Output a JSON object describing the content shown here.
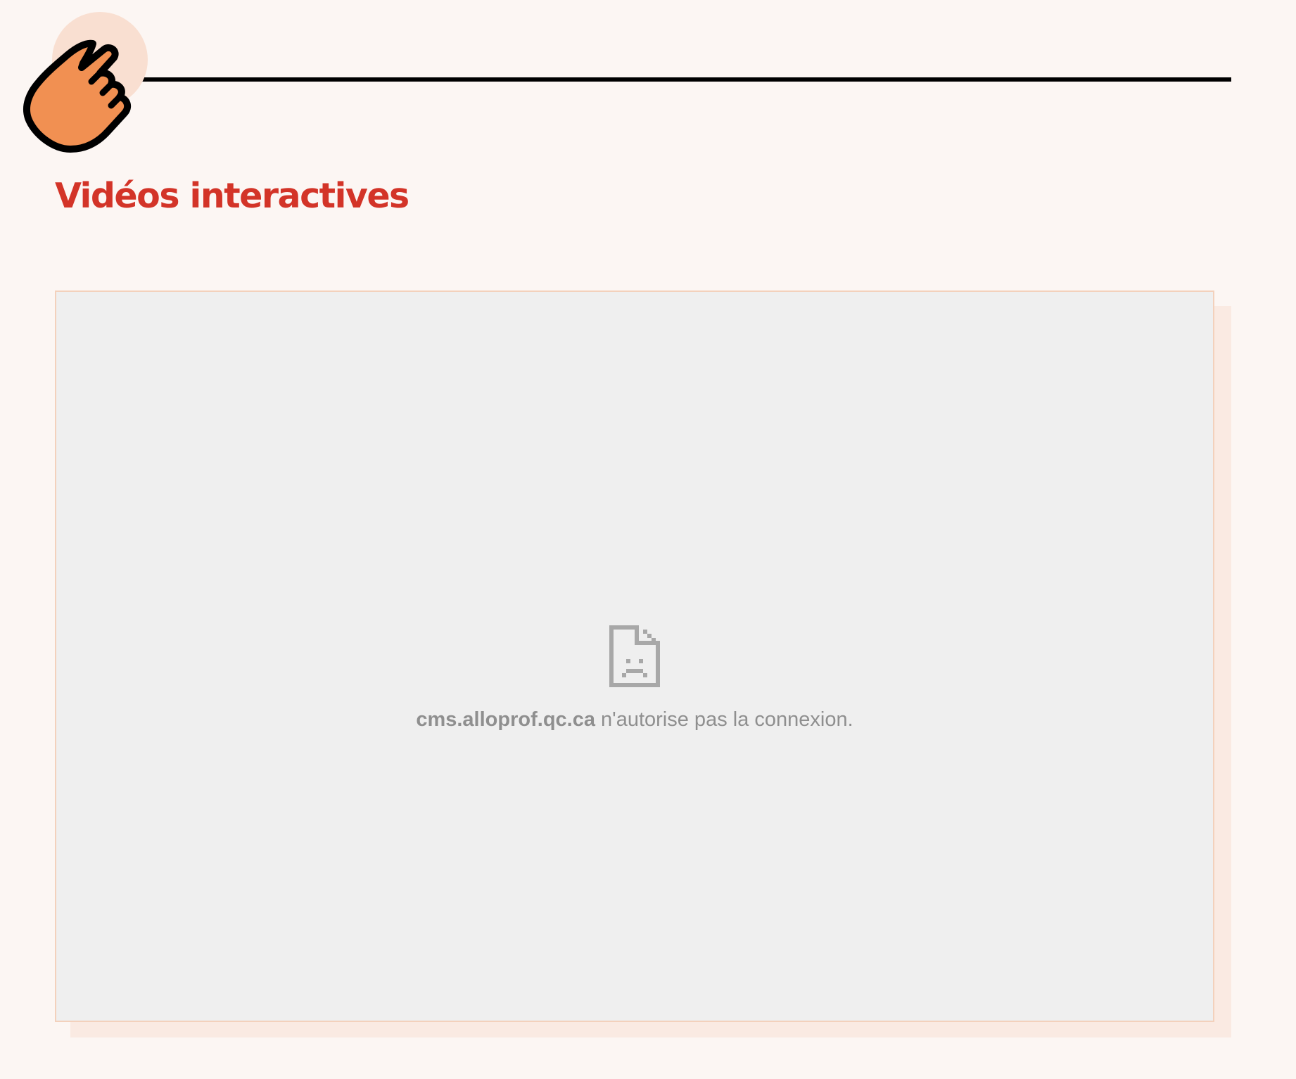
{
  "section": {
    "title": "Vidéos interactives",
    "icon": "pointing-hand-icon"
  },
  "embed": {
    "error_icon": "sad-document-icon",
    "domain": "cms.alloprof.qc.ca",
    "message": " n'autorise pas la connexion."
  },
  "colors": {
    "page_background": "#fcf6f3",
    "title": "#d33428",
    "icon_hand": "#f19052",
    "icon_circle": "#f9dfd1",
    "embed_background": "#efefef",
    "embed_border": "#f3d1bc",
    "embed_shadow": "#faeae2",
    "error_text": "#8f8f8f"
  }
}
